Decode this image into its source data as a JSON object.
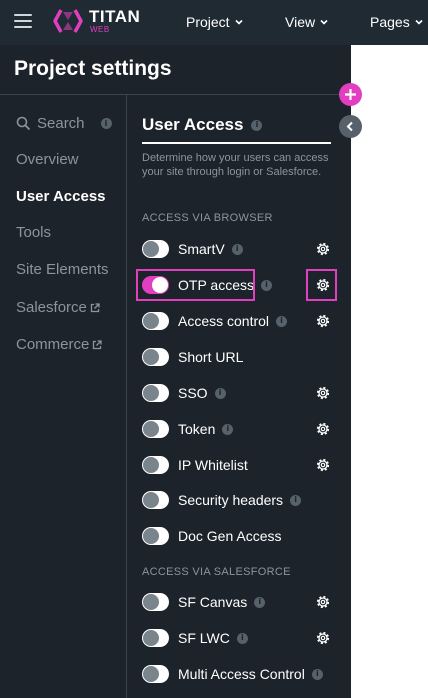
{
  "topnav": {
    "brand": "TITAN",
    "brand_sub": "WEB",
    "menus": [
      "Project",
      "View",
      "Pages"
    ]
  },
  "panel": {
    "title": "Project settings",
    "sidebar": [
      {
        "label": "Search",
        "info": true
      },
      {
        "label": "Overview"
      },
      {
        "label": "User Access",
        "active": true
      },
      {
        "label": "Tools"
      },
      {
        "label": "Site Elements"
      },
      {
        "label": "Salesforce",
        "external": true
      },
      {
        "label": "Commerce",
        "external": true
      }
    ]
  },
  "user_access": {
    "title": "User Access",
    "description": "Determine how your users can access your site through login or Salesforce.",
    "browser_group_label": "ACCESS VIA BROWSER",
    "salesforce_group_label": "ACCESS VIA SALESFORCE",
    "browser_items": [
      {
        "label": "SmartV",
        "on": false,
        "info": true,
        "settings": true
      },
      {
        "label": "OTP access",
        "on": true,
        "info": true,
        "settings": true
      },
      {
        "label": "Access control",
        "on": false,
        "info": true,
        "settings": true
      },
      {
        "label": "Short URL",
        "on": false,
        "info": false,
        "settings": false
      },
      {
        "label": "SSO",
        "on": false,
        "info": true,
        "settings": true
      },
      {
        "label": "Token",
        "on": false,
        "info": true,
        "settings": true
      },
      {
        "label": "IP Whitelist",
        "on": false,
        "info": false,
        "settings": true
      },
      {
        "label": "Security headers",
        "on": false,
        "info": true,
        "settings": false
      },
      {
        "label": "Doc Gen Access",
        "on": false,
        "info": false,
        "settings": false
      }
    ],
    "salesforce_items": [
      {
        "label": "SF Canvas",
        "on": false,
        "info": true,
        "settings": true
      },
      {
        "label": "SF LWC",
        "on": false,
        "info": true,
        "settings": true
      },
      {
        "label": "Multi Access Control",
        "on": false,
        "info": true,
        "settings": false
      }
    ]
  },
  "colors": {
    "accent": "#e23fc0",
    "topbar": "#1f2a33",
    "panel": "#1c232a",
    "muted_text": "#8b959e"
  },
  "icons": [
    "hamburger-icon",
    "titan-logo-icon",
    "chevron-down-icon",
    "search-icon",
    "info-icon",
    "external-link-icon",
    "gear-icon",
    "plus-icon",
    "chevron-left-icon"
  ]
}
